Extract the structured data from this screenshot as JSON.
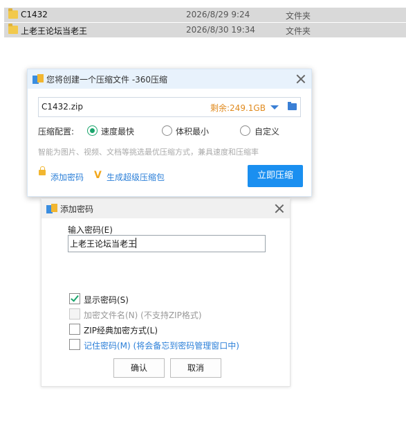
{
  "explorer": {
    "rows": [
      {
        "name": "C1432",
        "date": "2026/8/29 9:24",
        "type": "文件夹"
      },
      {
        "name": "上老王论坛当老王",
        "date": "2026/8/30 19:34",
        "type": "文件夹"
      }
    ]
  },
  "compress_dialog": {
    "title": "您将创建一个压缩文件 -360压缩",
    "filename": "C1432.zip",
    "free_space": "剩余:249.1GB",
    "config_label": "压缩配置:",
    "options": [
      {
        "label": "速度最快",
        "selected": true
      },
      {
        "label": "体积最小",
        "selected": false
      },
      {
        "label": "自定义",
        "selected": false
      }
    ],
    "hint": "智能为图片、视频、文档等挑选最优压缩方式，兼具速度和压缩率",
    "add_password": "添加密码",
    "super_pack": "生成超级压缩包",
    "compress_button": "立即压缩"
  },
  "password_dialog": {
    "title": "添加密码",
    "input_label": "输入密码(E)",
    "password_value": "上老王论坛当老王",
    "checkboxes": [
      {
        "label": "显示密码(S)",
        "checked": true,
        "disabled": false
      },
      {
        "label": "加密文件名(N) (不支持ZIP格式)",
        "checked": false,
        "disabled": true
      },
      {
        "label": "ZIP经典加密方式(L)",
        "checked": false,
        "disabled": false
      },
      {
        "label": "记住密码(M) (将会备忘到密码管理窗口中)",
        "checked": false,
        "disabled": false
      }
    ],
    "ok_button": "确认",
    "cancel_button": "取消"
  },
  "colors": {
    "accent_blue": "#1a8ff0",
    "check_green": "#1aa56c",
    "free_space_orange": "#e08a1e",
    "folder_yellow": "#f2c94c"
  }
}
